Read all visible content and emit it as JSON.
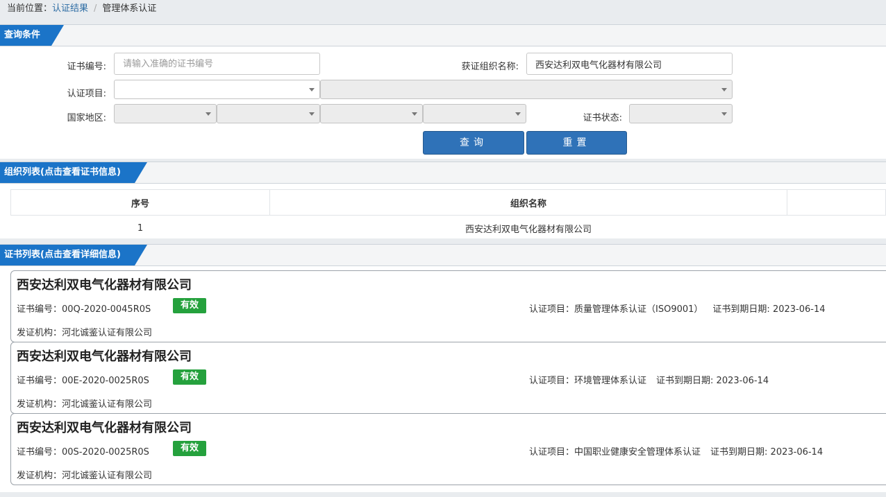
{
  "breadcrumb": {
    "prefix": "当前位置：",
    "link": "认证结果",
    "sep": "/",
    "current": "管理体系认证"
  },
  "query": {
    "tab": "查询条件",
    "cert_no_label": "证书编号:",
    "cert_no_placeholder": "请输入准确的证书编号",
    "cert_no_value": "",
    "org_name_label": "获证组织名称:",
    "org_name_value": "西安达利双电气化器材有限公司",
    "project_label": "认证项目:",
    "region_label": "国家地区:",
    "status_label": "证书状态:",
    "search_btn": "查询",
    "reset_btn": "重置"
  },
  "org_list": {
    "tab": "组织列表(点击查看证书信息)",
    "headers": [
      "序号",
      "组织名称"
    ],
    "rows": [
      {
        "index": "1",
        "name": "西安达利双电气化器材有限公司"
      }
    ]
  },
  "cert_list": {
    "tab": "证书列表(点击查看详细信息)",
    "labels": {
      "cert_no": "证书编号：",
      "project": "认证项目：",
      "expire": "证书到期日期: ",
      "issuer": "发证机构：",
      "status": "有效"
    },
    "items": [
      {
        "org": "西安达利双电气化器材有限公司",
        "cert_no": "00Q-2020-0045R0S",
        "status": "有效",
        "project": "质量管理体系认证（ISO9001）",
        "expire": "2023-06-14",
        "issuer": "河北诚鉴认证有限公司"
      },
      {
        "org": "西安达利双电气化器材有限公司",
        "cert_no": "00E-2020-0025R0S",
        "status": "有效",
        "project": "环境管理体系认证",
        "expire": "2023-06-14",
        "issuer": "河北诚鉴认证有限公司"
      },
      {
        "org": "西安达利双电气化器材有限公司",
        "cert_no": "00S-2020-0025R0S",
        "status": "有效",
        "project": "中国职业健康安全管理体系认证",
        "expire": "2023-06-14",
        "issuer": "河北诚鉴认证有限公司"
      }
    ]
  },
  "colors": {
    "accent": "#1b74c8",
    "button": "#2f72b8",
    "valid": "#25a13d"
  }
}
